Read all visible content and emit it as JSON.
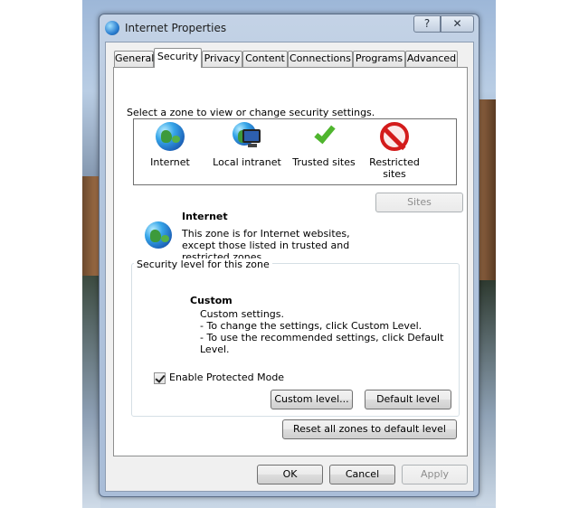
{
  "window": {
    "title": "Internet Properties",
    "help_label": "?",
    "close_label": "✕"
  },
  "tabs": [
    {
      "label": "General",
      "active": false
    },
    {
      "label": "Security",
      "active": true
    },
    {
      "label": "Privacy",
      "active": false
    },
    {
      "label": "Content",
      "active": false
    },
    {
      "label": "Connections",
      "active": false
    },
    {
      "label": "Programs",
      "active": false
    },
    {
      "label": "Advanced",
      "active": false
    }
  ],
  "security": {
    "zone_prompt": "Select a zone to view or change security settings.",
    "zones": [
      {
        "label": "Internet",
        "icon": "globe-icon"
      },
      {
        "label": "Local intranet",
        "icon": "intranet-icon"
      },
      {
        "label": "Trusted sites",
        "icon": "checkmark-icon"
      },
      {
        "label": "Restricted sites",
        "icon": "restricted-icon"
      }
    ],
    "selected_zone": {
      "title": "Internet",
      "description_line1": "This zone is for Internet websites,",
      "description_line2": "except those listed in trusted and",
      "description_line3": "restricted zones."
    },
    "sites_button": "Sites",
    "level_group_label": "Security level for this zone",
    "level_title": "Custom",
    "level_line1": "Custom settings.",
    "level_line2": "- To change the settings, click Custom Level.",
    "level_line3": "- To use the recommended settings, click Default Level.",
    "protected_mode_label": "Enable Protected Mode",
    "protected_mode_checked": true,
    "custom_level_button": "Custom level...",
    "default_level_button": "Default level",
    "reset_all_button": "Reset all zones to default level"
  },
  "footer": {
    "ok": "OK",
    "cancel": "Cancel",
    "apply": "Apply"
  }
}
